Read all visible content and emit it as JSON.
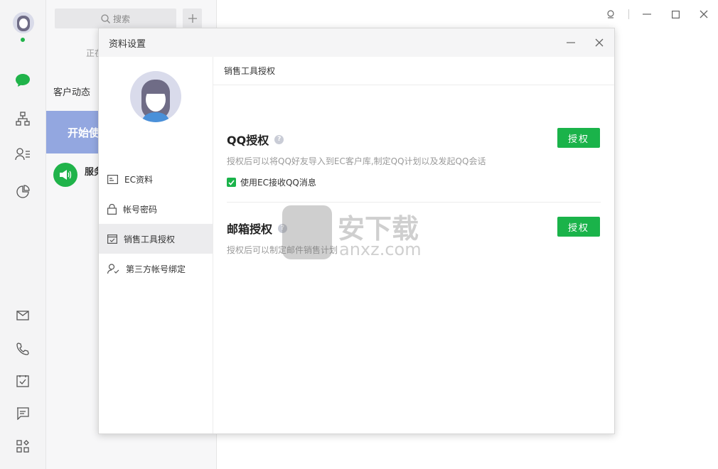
{
  "window": {
    "controls": [
      "pin-icon",
      "minimize-icon",
      "maximize-icon",
      "close-icon"
    ]
  },
  "rail": {
    "icons": [
      "chat-icon",
      "org-chart-icon",
      "contacts-icon",
      "pie-chart-icon",
      "mail-icon",
      "phone-icon",
      "task-icon",
      "message-icon",
      "apps-icon"
    ],
    "status_color": "#20b34a"
  },
  "middle": {
    "search_label": "搜索",
    "loading": "正在",
    "section_title": "客户动态",
    "banner": "开始使",
    "item_label": "服务"
  },
  "dialog": {
    "title": "资料设置",
    "sidebar": [
      {
        "label": "EC资料",
        "icon": "id-card-icon"
      },
      {
        "label": "帐号密码",
        "icon": "lock-icon"
      },
      {
        "label": "销售工具授权",
        "icon": "checklist-icon",
        "active": true
      },
      {
        "label": "第三方帐号绑定",
        "icon": "user-check-icon"
      }
    ],
    "main_header": "销售工具授权",
    "qq": {
      "title": "QQ授权",
      "button": "授权",
      "desc": "授权后可以将QQ好友导入到EC客户库,制定QQ计划以及发起QQ会话",
      "checkbox_label": "使用EC接收QQ消息",
      "checkbox_checked": true
    },
    "mail": {
      "title": "邮箱授权",
      "button": "授权",
      "desc": "授权后可以制定邮件销售计划"
    }
  },
  "watermark": {
    "text": "安下载",
    "sub": "anxz.com"
  },
  "colors": {
    "accent": "#1ab34a",
    "banner": "#93a7e0"
  }
}
